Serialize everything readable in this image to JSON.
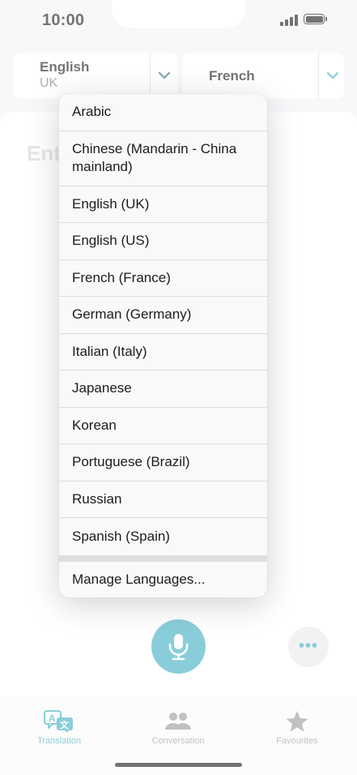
{
  "status_bar": {
    "time": "10:00"
  },
  "language_bar": {
    "source": {
      "name": "English",
      "region": "UK"
    },
    "target": {
      "name": "French"
    }
  },
  "input": {
    "placeholder": "Ent"
  },
  "language_menu": {
    "items": [
      "Arabic",
      "Chinese (Mandarin - China mainland)",
      "English (UK)",
      "English (US)",
      "French (France)",
      "German (Germany)",
      "Italian (Italy)",
      "Japanese",
      "Korean",
      "Portuguese (Brazil)",
      "Russian",
      "Spanish (Spain)"
    ],
    "manage": "Manage Languages..."
  },
  "actions": {
    "more_label": "•••"
  },
  "tab_bar": {
    "tabs": [
      {
        "label": "Translation",
        "icon": "translation-icon",
        "active": true
      },
      {
        "label": "Conversation",
        "icon": "people-icon",
        "active": false
      },
      {
        "label": "Favourites",
        "icon": "star-icon",
        "active": false
      }
    ]
  },
  "colors": {
    "accent": "#2ba4bc",
    "inactive": "#8e8e93"
  }
}
